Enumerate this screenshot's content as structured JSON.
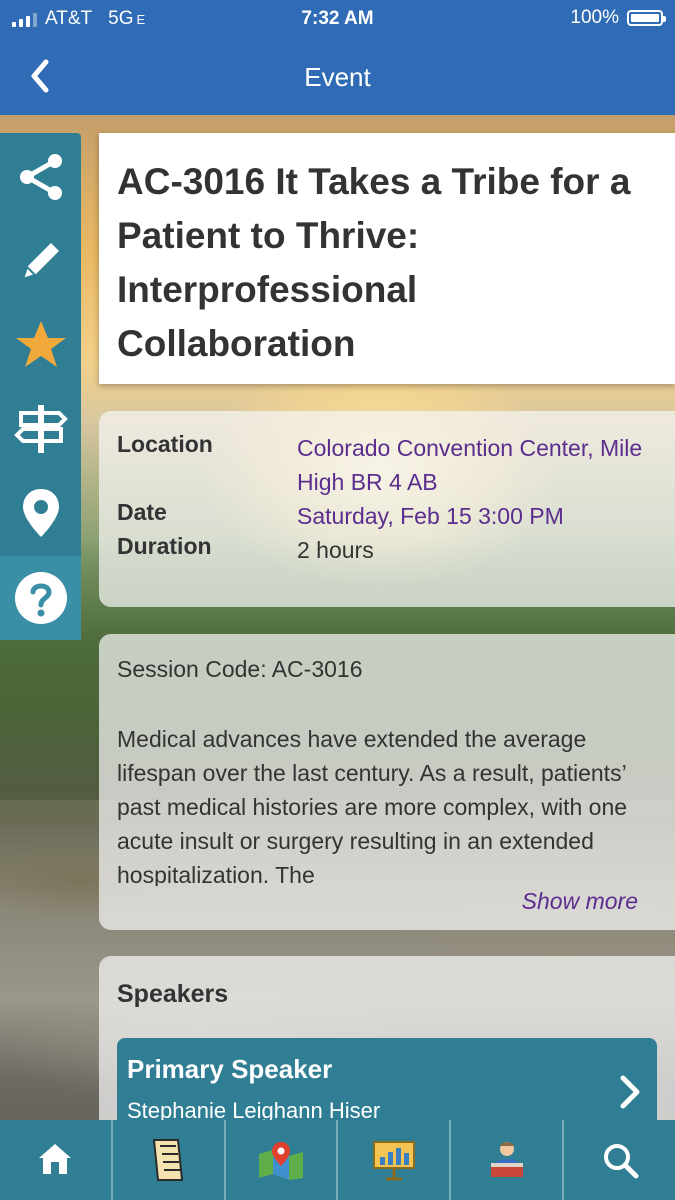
{
  "status_bar": {
    "carrier": "AT&T",
    "network": "5G",
    "network_suffix": "E",
    "time": "7:32 AM",
    "battery": "100%",
    "battery_level": 1.0
  },
  "navbar": {
    "title": "Event",
    "back_icon": "chevron-left-icon"
  },
  "action_rail": [
    {
      "name": "share",
      "icon": "share-icon"
    },
    {
      "name": "note",
      "icon": "pencil-icon"
    },
    {
      "name": "favorite",
      "icon": "star-icon"
    },
    {
      "name": "signpost",
      "icon": "signpost-icon"
    },
    {
      "name": "location",
      "icon": "map-pin-icon"
    },
    {
      "name": "help",
      "icon": "help-icon"
    }
  ],
  "event": {
    "title": "AC-3016 It Takes a Tribe for a Patient to Thrive: Interprofessional Collaboration",
    "location_label": "Location",
    "location_value": "Colorado Convention Center, Mile High BR 4 AB",
    "date_label": "Date",
    "date_value": "Saturday, Feb 15 3:00 PM",
    "duration_label": "Duration",
    "duration_value": "2 hours",
    "session_code": "Session Code: AC-3016",
    "description": "Medical advances have extended the average lifespan over the last century. As a result, patients’ past medical histories are more complex, with one acute insult or surgery resulting in an extended hospitalization. The",
    "show_more": "Show more"
  },
  "speakers": {
    "header": "Speakers",
    "items": [
      {
        "role": "Primary Speaker",
        "name": "Stephanie Leighann Hiser"
      }
    ]
  },
  "tab_bar": [
    {
      "name": "home",
      "icon": "home-icon"
    },
    {
      "name": "guide",
      "icon": "book-icon"
    },
    {
      "name": "map",
      "icon": "map-icon"
    },
    {
      "name": "exhibits",
      "icon": "presentation-board-icon"
    },
    {
      "name": "speakers",
      "icon": "speaker-icon"
    },
    {
      "name": "search",
      "icon": "search-icon"
    }
  ],
  "colors": {
    "header_blue": "#2f6cb5",
    "rail_teal": "#2f7e94",
    "link_purple": "#5b2d8e",
    "star_gold": "#f2a93b"
  }
}
